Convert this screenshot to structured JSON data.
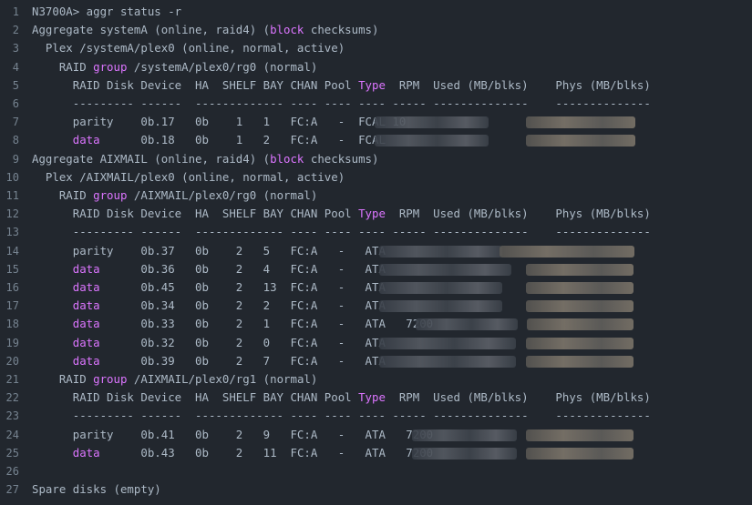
{
  "title_line": "N3700A> aggr status -r",
  "lines": [
    {
      "n": "1",
      "t": "N3700A> aggr status -r"
    },
    {
      "n": "2",
      "a": "Aggregate systemA (online, raid4) (",
      "kw": "block",
      "b": " checksums)"
    },
    {
      "n": "3",
      "t": "  Plex /systemA/plex0 (online, normal, active)"
    },
    {
      "n": "4",
      "a": "    RAID ",
      "kw": "group",
      "b": " /systemA/plex0/rg0 (normal)"
    },
    {
      "n": "5",
      "a": "      RAID Disk Device  HA  SHELF BAY CHAN Pool ",
      "kw": "Type",
      "b": "  RPM  Used (MB/blks)    Phys (MB/blks)"
    },
    {
      "n": "6",
      "t": "      --------- ------  ------------- ---- ---- ---- ----- --------------    --------------"
    },
    {
      "n": "7",
      "t": "      parity    0b.17   0b    1   1   FC:A   -  FCAL 10"
    },
    {
      "n": "8",
      "t": "      data      0b.18   0b    1   2   FC:A   -  FCAL"
    },
    {
      "n": "9",
      "a": "Aggregate AIXMAIL (online, raid4) (",
      "kw": "block",
      "b": " checksums)"
    },
    {
      "n": "10",
      "t": "  Plex /AIXMAIL/plex0 (online, normal, active)"
    },
    {
      "n": "11",
      "a": "    RAID ",
      "kw": "group",
      "b": " /AIXMAIL/plex0/rg0 (normal)"
    },
    {
      "n": "12",
      "a": "      RAID Disk Device  HA  SHELF BAY CHAN Pool ",
      "kw": "Type",
      "b": "  RPM  Used (MB/blks)    Phys (MB/blks)"
    },
    {
      "n": "13",
      "t": "      --------- ------  ------------- ---- ---- ---- ----- --------------    --------------"
    },
    {
      "n": "14",
      "t": "      parity    0b.37   0b    2   5   FC:A   -   ATA"
    },
    {
      "n": "15",
      "t": "      data      0b.36   0b    2   4   FC:A   -   ATA"
    },
    {
      "n": "16",
      "t": "      data      0b.45   0b    2   13  FC:A   -   ATA"
    },
    {
      "n": "17",
      "t": "      data      0b.34   0b    2   2   FC:A   -   ATA"
    },
    {
      "n": "18",
      "t": "      data      0b.33   0b    2   1   FC:A   -   ATA   7200"
    },
    {
      "n": "19",
      "t": "      data      0b.32   0b    2   0   FC:A   -   ATA"
    },
    {
      "n": "20",
      "t": "      data      0b.39   0b    2   7   FC:A   -   ATA"
    },
    {
      "n": "21",
      "a": "    RAID ",
      "kw": "group",
      "b": " /AIXMAIL/plex0/rg1 (normal)"
    },
    {
      "n": "22",
      "a": "      RAID Disk Device  HA  SHELF BAY CHAN Pool ",
      "kw": "Type",
      "b": "  RPM  Used (MB/blks)    Phys (MB/blks)"
    },
    {
      "n": "23",
      "t": "      --------- ------  ------------- ---- ---- ---- ----- --------------    --------------"
    },
    {
      "n": "24",
      "t": "      parity    0b.41   0b    2   9   FC:A   -   ATA   7200"
    },
    {
      "n": "25",
      "t": "      data      0b.43   0b    2   11  FC:A   -   ATA   7200"
    },
    {
      "n": "26",
      "t": ""
    },
    {
      "n": "27",
      "t": "Spare disks (empty)"
    }
  ],
  "colors": {
    "background": "#22272e",
    "text": "#adbac7",
    "line_numbers": "#768390",
    "keyword": "#dc75ff"
  }
}
